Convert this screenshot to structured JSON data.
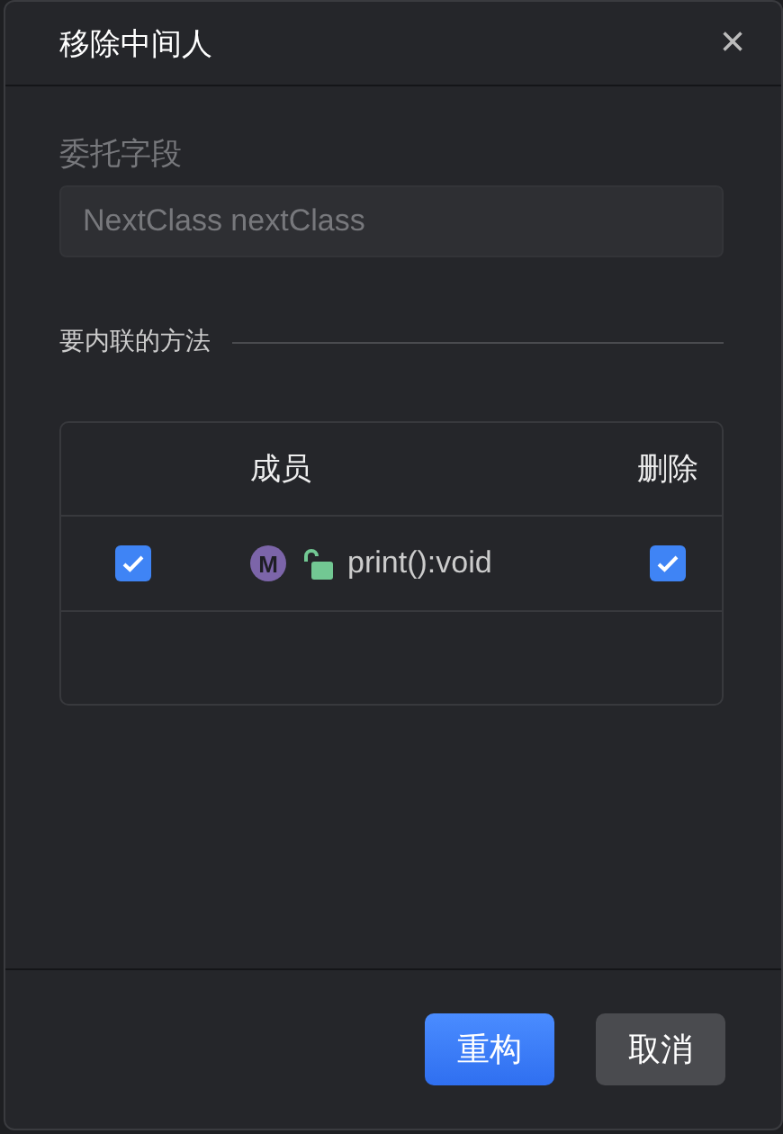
{
  "dialog": {
    "title": "移除中间人",
    "close": "×"
  },
  "delegate_field": {
    "label": "委托字段",
    "value": "NextClass nextClass",
    "disabled": true
  },
  "section": {
    "title": "要内联的方法"
  },
  "table": {
    "columns": [
      "成员",
      "删除"
    ],
    "rows": [
      {
        "selected": true,
        "badge": "M",
        "name": "print():void",
        "delete": true
      }
    ]
  },
  "buttons": [
    {
      "label": "重构",
      "kind": "primary"
    },
    {
      "label": "取消",
      "kind": "secondary"
    }
  ]
}
